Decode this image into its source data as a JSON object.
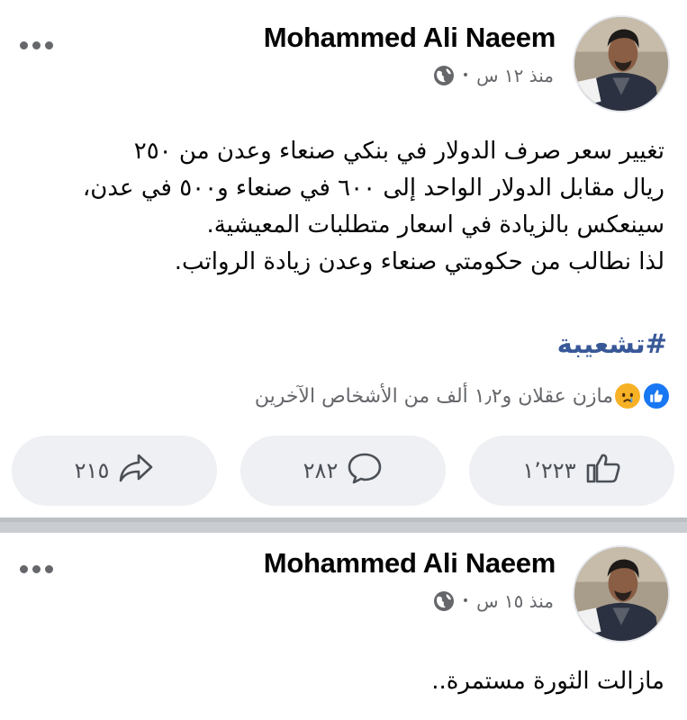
{
  "posts": [
    {
      "author": "Mohammed Ali Naeem",
      "time": "منذ ١٢ س",
      "text_lines": [
        "تغيير سعر صرف الدولار في بنكي صنعاء وعدن من ٢٥٠",
        "ريال مقابل الدولار الواحد إلى ٦٠٠ في صنعاء و٥٠٠ في عدن،",
        "سينعكس  بالزيادة في اسعار متطلبات المعيشية.",
        "لذا نطالب من حكومتي صنعاء وعدن زيادة الرواتب."
      ],
      "hashtag": "#تشعيبة",
      "reactions_text": "مازن عقلان و١٫٢ ألف من الأشخاص الآخرين",
      "reaction_icons": [
        "like-icon",
        "sad-icon"
      ],
      "likes": "١٬٢٢٣",
      "comments": "٢٨٢",
      "shares": "٢١٥"
    },
    {
      "author": "Mohammed Ali Naeem",
      "time": "منذ ١٥ س",
      "text_lines": [
        "مازالت الثورة مستمرة.."
      ]
    }
  ],
  "colors": {
    "hashtag": "#385898",
    "secondary_text": "#65676b",
    "button_bg": "#eef0f3",
    "like_blue": "#1877f2",
    "sad_yellow": "#f7b125"
  }
}
